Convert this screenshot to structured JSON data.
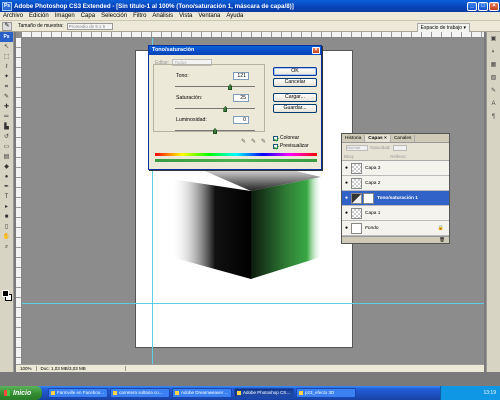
{
  "window": {
    "title": "Adobe Photoshop CS3 Extended - [Sin título-1 al 100% (Tono/saturación 1, máscara de capa/8)]",
    "app_icon": "Ps"
  },
  "menu": [
    "Archivo",
    "Edición",
    "Imagen",
    "Capa",
    "Selección",
    "Filtro",
    "Análisis",
    "Vista",
    "Ventana",
    "Ayuda"
  ],
  "options_bar": {
    "sample_size_label": "Tamaño de muestra:",
    "sample_size_value": "Promedio de 5 x 5",
    "workspace_label": "Espacio de trabajo ▾"
  },
  "dialog": {
    "title": "Tono/saturación",
    "edit_label": "Editar:",
    "edit_value": "Todos",
    "hue_label": "Tono:",
    "hue_value": "121",
    "saturation_label": "Saturación:",
    "saturation_value": "25",
    "lightness_label": "Luminosidad:",
    "lightness_value": "0",
    "hue_level": 0.69,
    "saturation_level": 0.63,
    "lightness_level": 0.5,
    "ok_label": "OK",
    "cancel_label": "Cancelar",
    "load_label": "Cargar...",
    "save_label": "Guardar...",
    "colorize_label": "Colorear",
    "colorize_checked": true,
    "preview_label": "Previsualizar",
    "preview_checked": true
  },
  "layers_panel": {
    "tabs": [
      "Historia",
      "Capas ×",
      "Canales"
    ],
    "blend_mode": "Normal",
    "opacity_label": "Opacidad:",
    "fill_label": "Relleno:",
    "lock_label": "Bloq:",
    "layers": [
      {
        "name": "Capa 3",
        "selected": false
      },
      {
        "name": "Capa 2",
        "selected": false
      },
      {
        "name": "Tono/saturación 1",
        "selected": true
      },
      {
        "name": "Capa 1",
        "selected": false
      },
      {
        "name": "Fondo",
        "selected": false
      }
    ]
  },
  "status": {
    "zoom": "100%",
    "doc_info": "Doc: 1,03 MB/3,03 MB"
  },
  "taskbar": {
    "start_label": "Inicio",
    "tasks": [
      {
        "label": "Farmville en Faceboo...",
        "active": false
      },
      {
        "label": "carretera soltaria co...",
        "active": false
      },
      {
        "label": "Adobe Dreamweaver ...",
        "active": false
      },
      {
        "label": "Adobe Photoshop CS...",
        "active": true
      },
      {
        "label": "p23_efecto 3D",
        "active": false
      }
    ],
    "clock": "13:19"
  },
  "colors": {
    "title_blue": "#0842b8",
    "selected_layer": "#3062c8",
    "cube_tint": "#39a845"
  }
}
